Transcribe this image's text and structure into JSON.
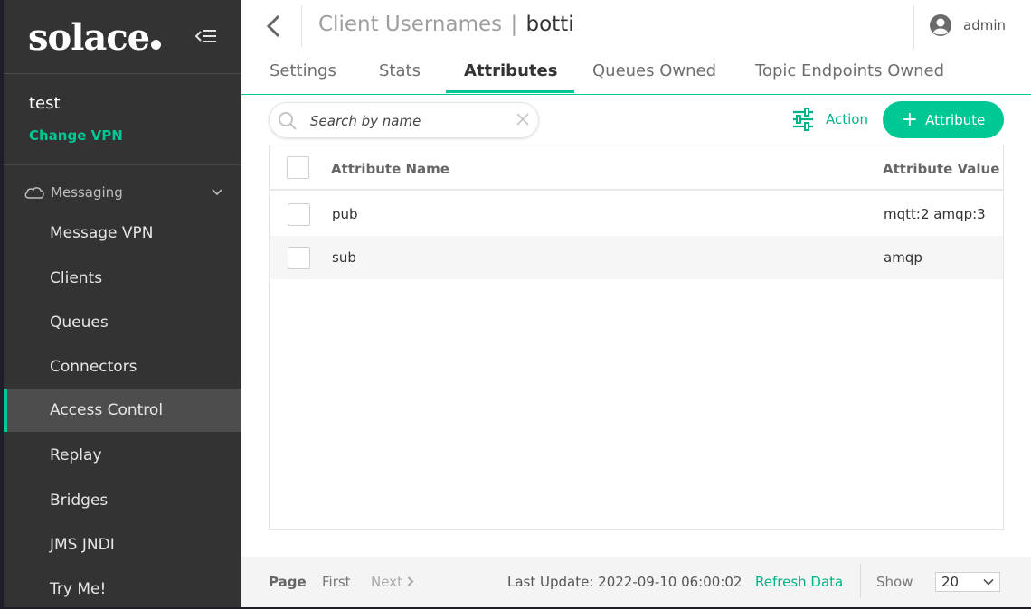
{
  "sidebar": {
    "logo": "solace",
    "vpn_name": "test",
    "change_vpn": "Change VPN",
    "section": "Messaging",
    "items": [
      {
        "label": "Message VPN"
      },
      {
        "label": "Clients"
      },
      {
        "label": "Queues"
      },
      {
        "label": "Connectors"
      },
      {
        "label": "Access Control"
      },
      {
        "label": "Replay"
      },
      {
        "label": "Bridges"
      },
      {
        "label": "JMS JNDI"
      },
      {
        "label": "Try Me!"
      }
    ],
    "active_item": "Access Control"
  },
  "header": {
    "breadcrumb": "Client Usernames",
    "separator": "|",
    "object_name": "botti",
    "user": "admin"
  },
  "tabs": [
    {
      "label": "Settings"
    },
    {
      "label": "Stats"
    },
    {
      "label": "Attributes"
    },
    {
      "label": "Queues Owned"
    },
    {
      "label": "Topic Endpoints Owned"
    }
  ],
  "active_tab": "Attributes",
  "toolbar": {
    "search_placeholder": "Search by name",
    "action_label": "Action",
    "add_label": "Attribute"
  },
  "table": {
    "columns": [
      "Attribute Name",
      "Attribute Value"
    ],
    "rows": [
      {
        "name": "pub",
        "value": "mqtt:2 amqp:3"
      },
      {
        "name": "sub",
        "value": "amqp"
      }
    ]
  },
  "footer": {
    "page_label": "Page",
    "first_label": "First",
    "next_label": "Next",
    "last_update": "Last Update: 2022-09-10 06:00:02",
    "refresh_label": "Refresh Data",
    "show_label": "Show",
    "page_size": "20"
  },
  "colors": {
    "accent": "#00c895",
    "sidebar_bg": "#333333",
    "active_item_bg": "#4d4d4d"
  }
}
